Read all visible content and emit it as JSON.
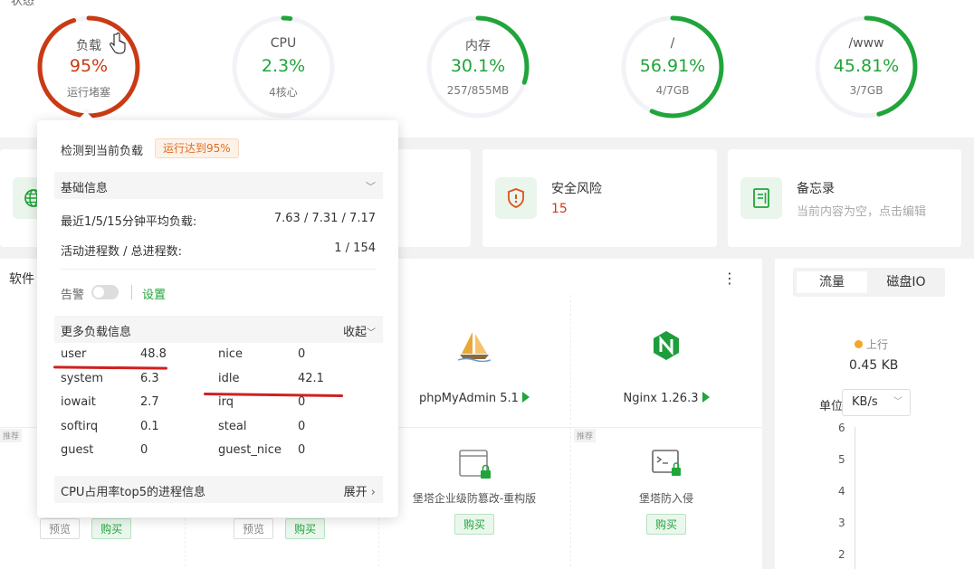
{
  "status": {
    "title": "状态",
    "gauges": [
      {
        "name": "负载",
        "value": "95%",
        "sub": "运行堵塞",
        "percent": 95,
        "color": "#c93a15"
      },
      {
        "name": "CPU",
        "value": "2.3%",
        "sub": "4核心",
        "percent": 2.3,
        "color": "#20a53a"
      },
      {
        "name": "内存",
        "value": "30.1%",
        "sub": "257/855MB",
        "percent": 30.1,
        "color": "#20a53a"
      },
      {
        "name": "/",
        "value": "56.91%",
        "sub": "4/7GB",
        "percent": 56.91,
        "color": "#20a53a"
      },
      {
        "name": "/www",
        "value": "45.81%",
        "sub": "3/7GB",
        "percent": 45.81,
        "color": "#20a53a"
      }
    ]
  },
  "cards": {
    "risk_title": "安全风险",
    "risk_count": "15",
    "memo_title": "备忘录",
    "memo_sub": "当前内容为空，点击编辑"
  },
  "software": {
    "label": "软件",
    "kebab": "⋮",
    "apps": [
      {
        "name": "phpMyAdmin 5.1"
      },
      {
        "name": "Nginx 1.26.3"
      }
    ],
    "tag": "推荐",
    "bottom_apps": [
      {
        "name": "堡塔企业级防篡改-重构版",
        "buy": "购买"
      },
      {
        "name": "堡塔防入侵",
        "buy": "购买"
      }
    ],
    "preview": "预览",
    "buy": "购买"
  },
  "traffic": {
    "tab_active": "流量",
    "tab_other": "磁盘IO",
    "up_label": "上行",
    "up_value": "0.45 KB",
    "unit_label": "单位",
    "unit_value": "KB/s",
    "y_ticks": [
      "6",
      "5",
      "4",
      "3",
      "2"
    ]
  },
  "popover": {
    "head": "检测到当前负载",
    "badge": "运行达到95%",
    "basic_title": "基础信息",
    "avg_label": "最近1/5/15分钟平均负载:",
    "avg_value": "7.63 / 7.31 / 7.17",
    "proc_label": "活动进程数 / 总进程数:",
    "proc_value": "1 / 154",
    "alarm_label": "告警",
    "settings_link": "设置",
    "more_title": "更多负载信息",
    "more_toggle": "收起",
    "stats": [
      {
        "k": "user",
        "v": "48.8"
      },
      {
        "k": "nice",
        "v": "0"
      },
      {
        "k": "system",
        "v": "6.3"
      },
      {
        "k": "idle",
        "v": "42.1"
      },
      {
        "k": "iowait",
        "v": "2.7"
      },
      {
        "k": "irq",
        "v": "0"
      },
      {
        "k": "softirq",
        "v": "0.1"
      },
      {
        "k": "steal",
        "v": "0"
      },
      {
        "k": "guest",
        "v": "0"
      },
      {
        "k": "guest_nice",
        "v": "0"
      }
    ],
    "top5_title": "CPU占用率top5的进程信息",
    "top5_toggle": "展开"
  }
}
